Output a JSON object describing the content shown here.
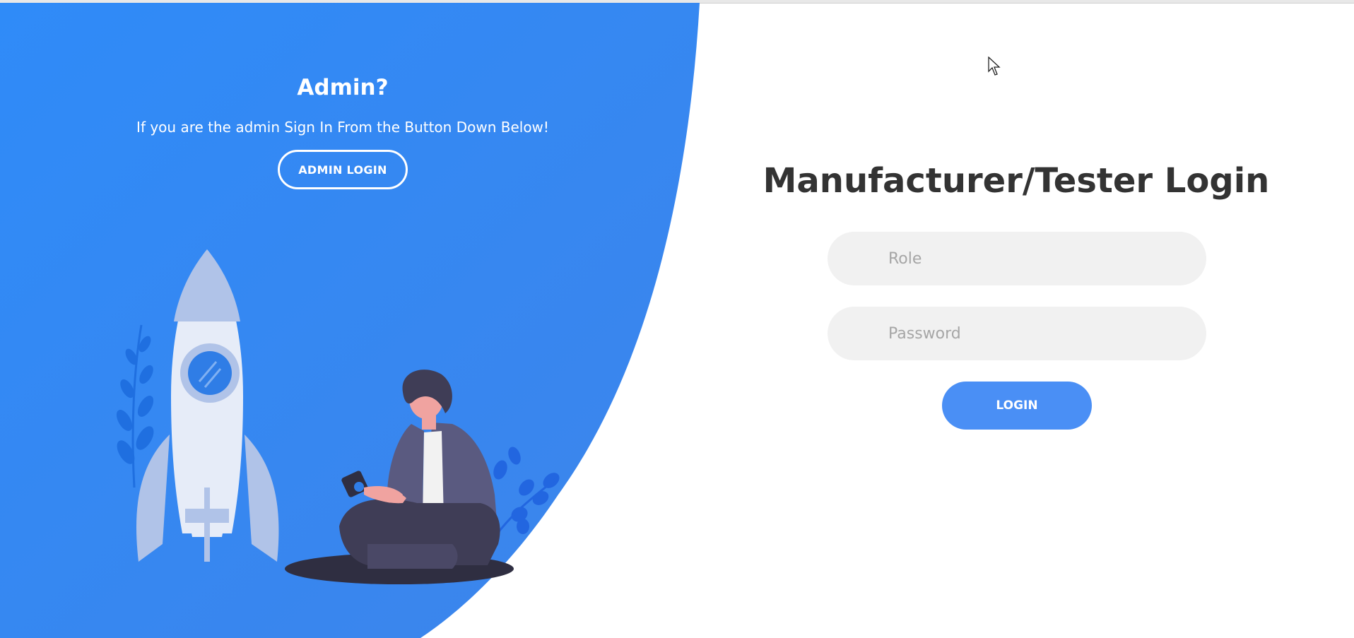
{
  "admin_panel": {
    "title": "Admin?",
    "subtitle": "If you are the admin Sign In From the Button Down Below!",
    "button_label": "ADMIN LOGIN"
  },
  "login_form": {
    "title": "Manufacturer/Tester Login",
    "role_placeholder": "Role",
    "password_placeholder": "Password",
    "login_label": "LOGIN"
  },
  "colors": {
    "panel_blue": "#2e8cf5",
    "button_blue": "#4a8ff5",
    "input_bg": "#f1f1f1",
    "title_text": "#333333"
  },
  "icons": {
    "illustration": "rocket-and-person-illustration",
    "cursor": "mouse-pointer-icon"
  }
}
